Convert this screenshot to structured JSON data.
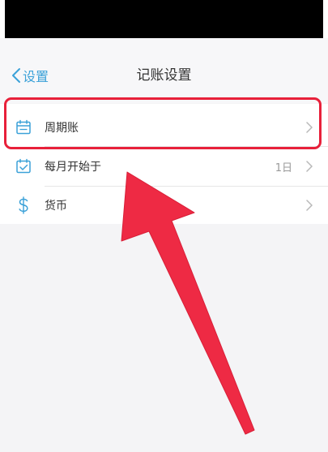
{
  "nav": {
    "back_label": "设置",
    "title": "记账设置"
  },
  "settings": {
    "items": [
      {
        "label": "周期账",
        "value": "",
        "icon": "calendar-icon"
      },
      {
        "label": "每月开始于",
        "value": "1日",
        "icon": "calendar-check-icon"
      },
      {
        "label": "货币",
        "value": "",
        "icon": "currency-icon"
      }
    ]
  },
  "colors": {
    "accent": "#3ba1d8",
    "highlight": "#e8203a",
    "arrow": "#ee2a44"
  }
}
